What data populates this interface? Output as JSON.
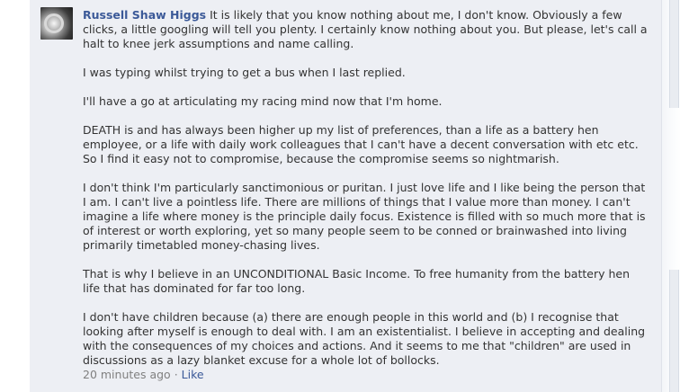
{
  "comment": {
    "author": "Russell Shaw Higgs",
    "paragraphs": [
      "It is likely that you know nothing about me, I don't know. Obviously a few clicks, a little googling will tell you plenty. I certainly know nothing about you. But please, let's call a halt to knee jerk assumptions and name calling.",
      "I was typing whilst trying to get a bus when I last replied.",
      "I'll have a go at articulating my racing mind now that I'm home.",
      "DEATH is and has always been higher up my list of preferences, than a life as a battery hen employee, or a life with daily work colleagues that I can't have a decent conversation with etc etc. So I find it easy not to compromise, because the compromise seems so nightmarish.",
      "I don't think I'm particularly sanctimonious or puritan. I just love life and I like being the person that I am. I can't live a pointless life. There are millions of things that I value more than money. I can't imagine a life where money is the principle daily focus. Existence is filled with so much more that is of interest or worth exploring, yet so many people seem to be conned or brainwashed into living primarily timetabled money-chasing lives.",
      "That is why I believe in an UNCONDITIONAL Basic Income. To free humanity from the battery hen life that has dominated for far too long.",
      "I don't have children because (a) there are enough people in this world and (b) I recognise that looking after myself is enough to deal with. I am an existentialist. I believe in accepting and dealing with the consequences of my choices and actions. And it seems to me that \"children\" are used in discussions as a lazy blanket excuse for a whole lot of bollocks."
    ],
    "timestamp": "20 minutes ago",
    "separator": "·",
    "like_label": "Like"
  },
  "colors": {
    "comment_bg": "#edeff4",
    "link": "#3b5998",
    "text": "#333333",
    "meta": "#808080"
  },
  "icons": {
    "avatar": "profile-photo"
  }
}
